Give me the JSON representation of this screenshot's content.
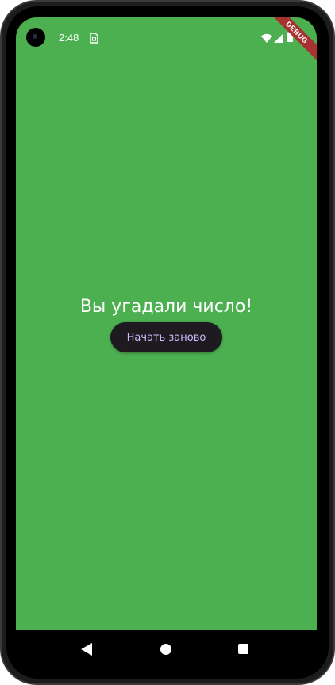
{
  "status_bar": {
    "time": "2:48",
    "icons": [
      "camera-icon",
      "sim-icon",
      "wifi-icon",
      "signal-icon",
      "battery-icon"
    ]
  },
  "debug_banner": {
    "label": "DEBUG"
  },
  "main": {
    "message": "Вы угадали число!",
    "restart_button_label": "Начать заново",
    "background_color": "#4caf50",
    "button_color": "#1d1b20",
    "button_text_color": "#d0bcff"
  },
  "nav_bar": {
    "icons": [
      "back-icon",
      "home-icon",
      "recents-icon"
    ]
  }
}
